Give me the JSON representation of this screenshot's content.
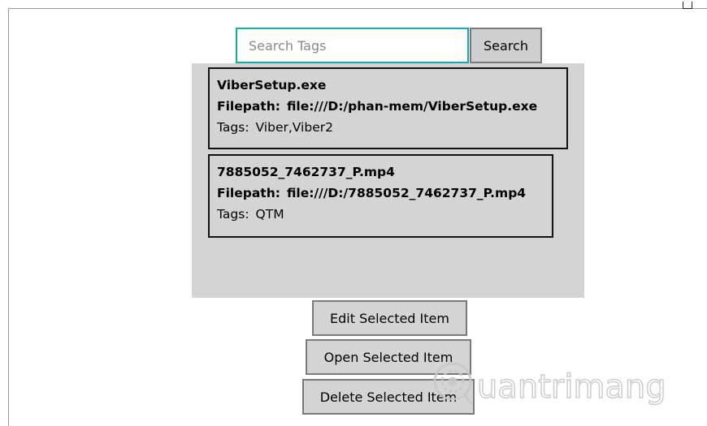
{
  "search": {
    "placeholder": "Search Tags",
    "value": "",
    "button_label": "Search"
  },
  "results": [
    {
      "name": "ViberSetup.exe",
      "filepath_label": "Filepath:",
      "filepath": "file:///D:/phan-mem/ViberSetup.exe",
      "tags_label": "Tags:",
      "tags": "Viber,Viber2"
    },
    {
      "name": "7885052_7462737_P.mp4",
      "filepath_label": "Filepath:",
      "filepath": "file:///D:/7885052_7462737_P.mp4",
      "tags_label": "Tags:",
      "tags": "QTM"
    }
  ],
  "actions": {
    "edit_label": "Edit Selected Item",
    "open_label": "Open Selected Item",
    "delete_label": "Delete Selected Item"
  },
  "watermark": {
    "text": "uantrimang",
    "icon": "quantrimang-logo-icon"
  },
  "colors": {
    "search_focus_border": "#1aa6b7",
    "panel_background": "#d4d4d4",
    "button_background": "#d4d4d4",
    "watermark": "#c8c8c8"
  }
}
